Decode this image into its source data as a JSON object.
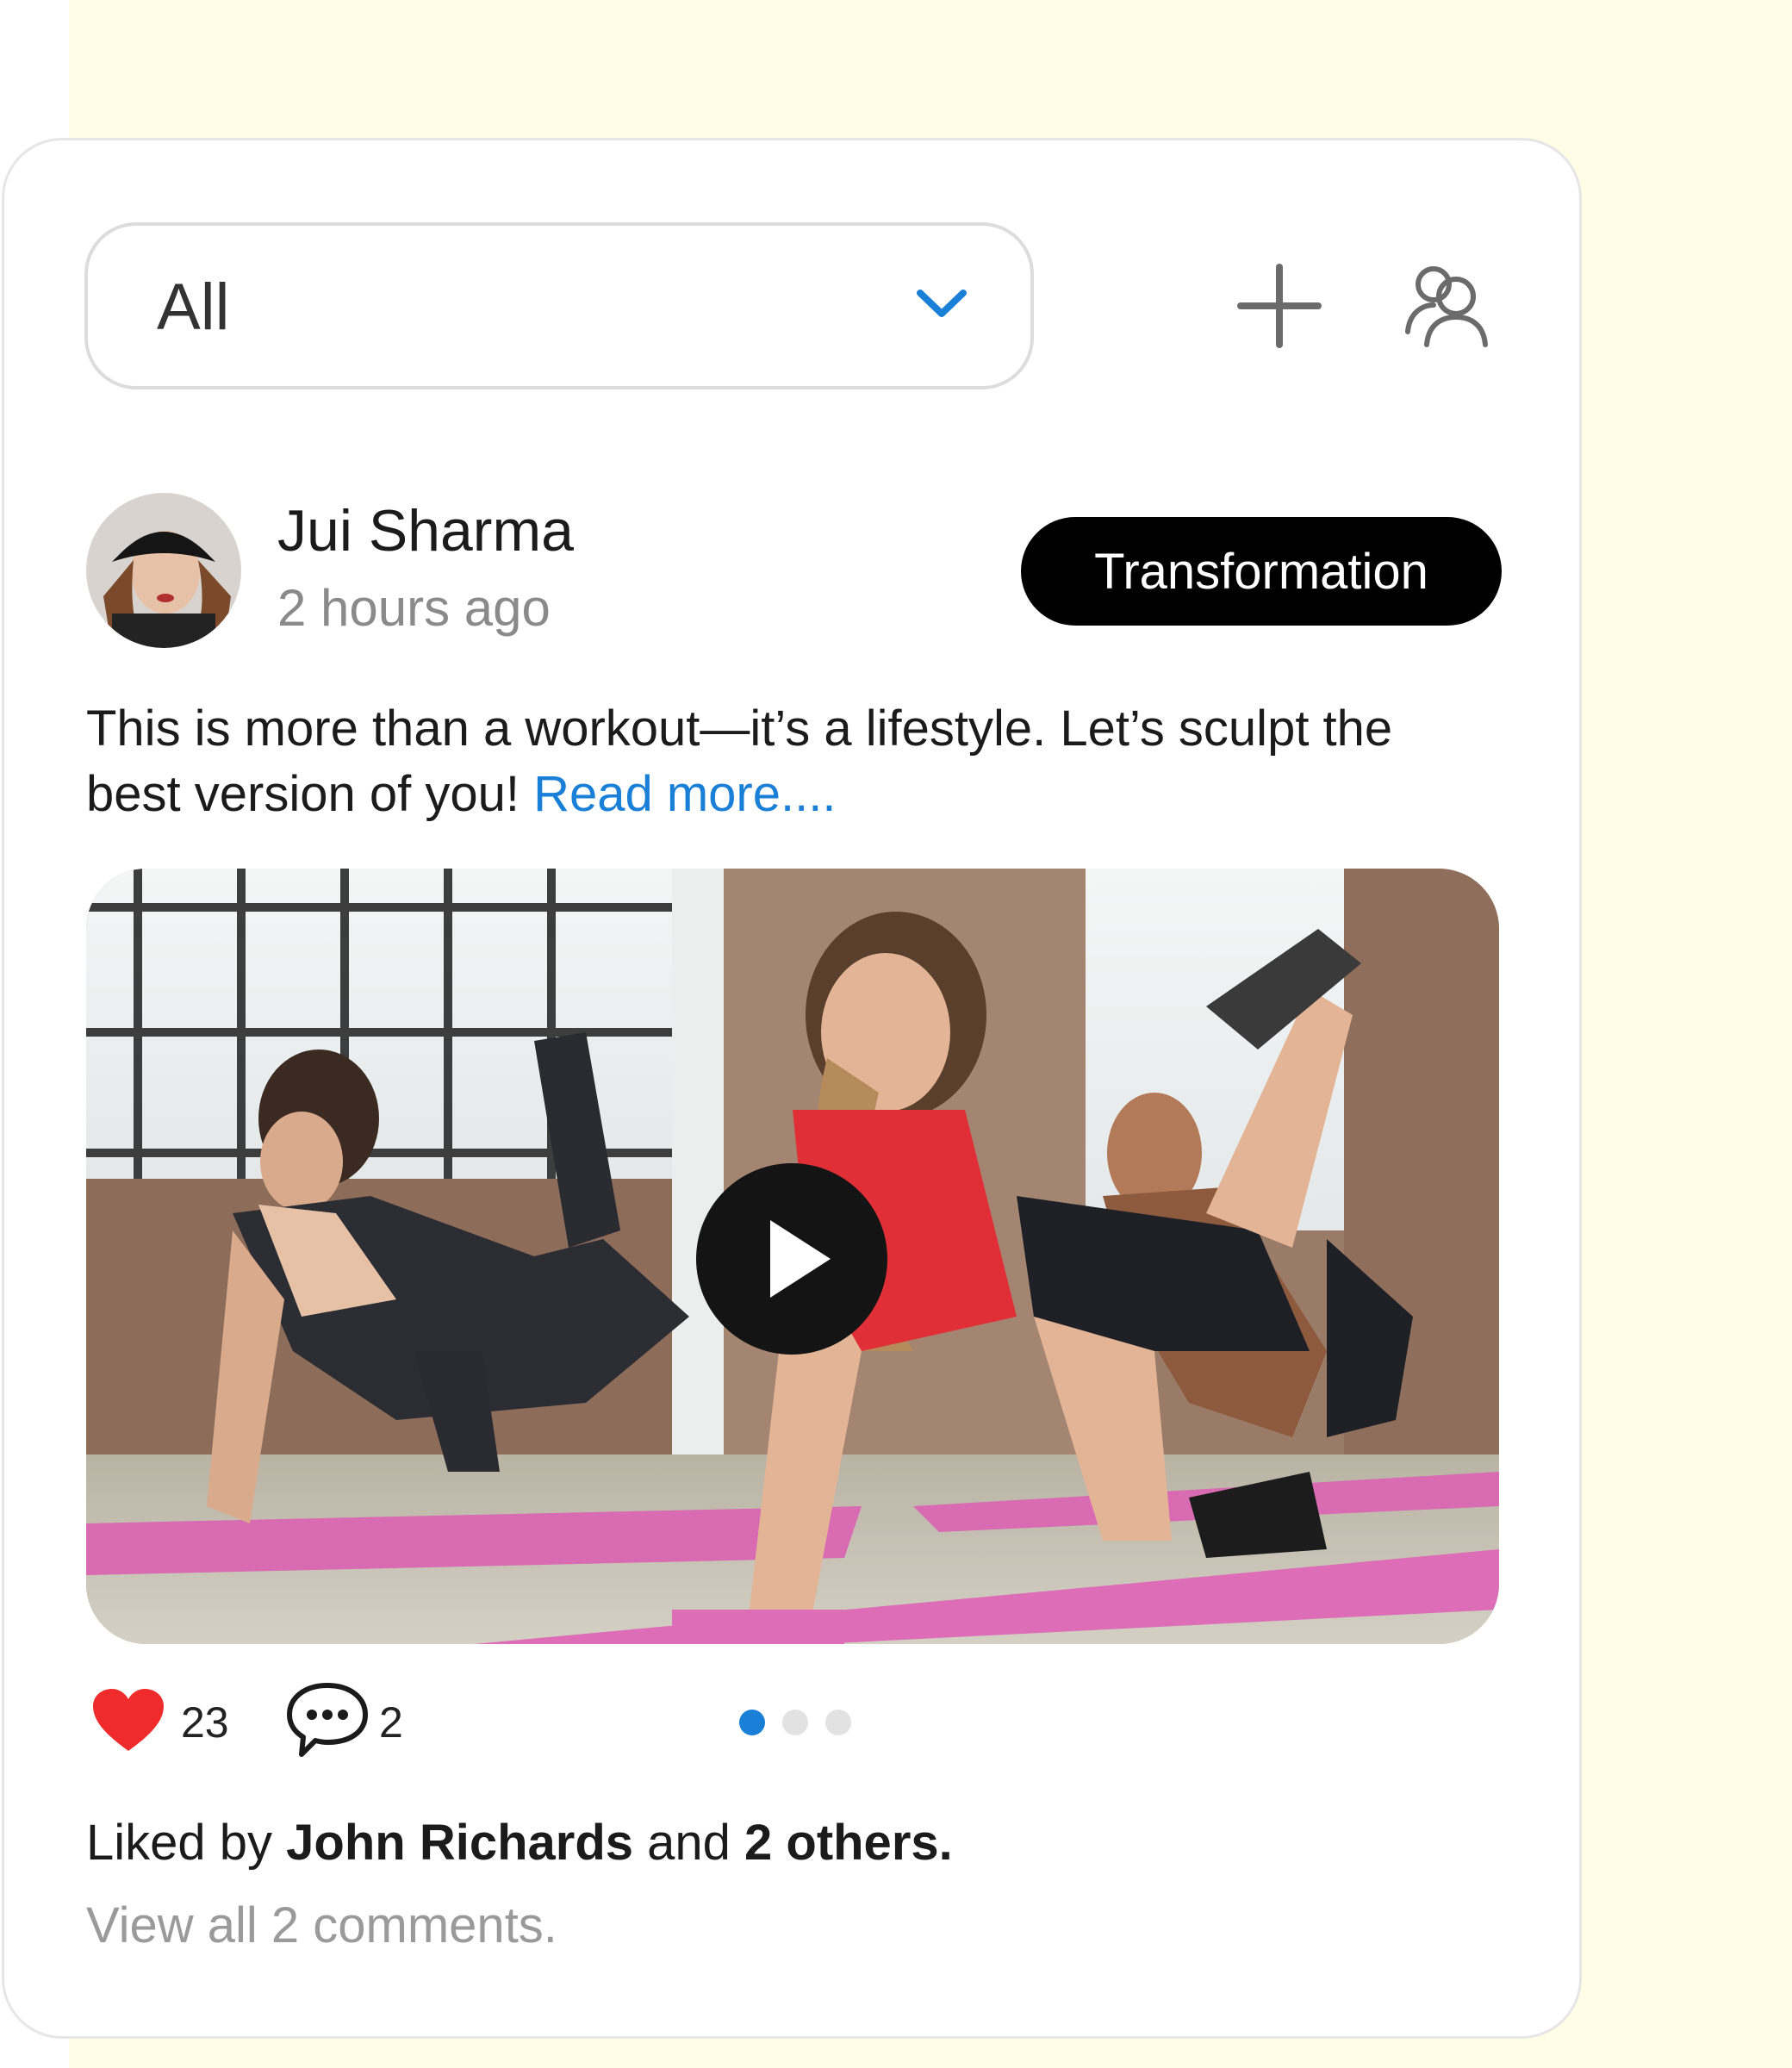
{
  "filter": {
    "value": "All"
  },
  "post": {
    "author": "Jui Sharma",
    "time": "2 hours ago",
    "tag": "Transformation",
    "caption": "This is more than a workout—it’s a lifestyle. Let’s sculpt the best version of you! ",
    "read_more": "Read more....",
    "likes": "23",
    "comments": "2",
    "carousel": {
      "count": 3,
      "active": 0
    },
    "liked_by_prefix": "Liked by ",
    "liked_by_name": "John Richards",
    "liked_by_mid": " and ",
    "liked_by_others": "2 others.",
    "view_comments": "View all 2 comments."
  },
  "colors": {
    "accent": "#1a7fd6",
    "heart": "#ef2b2b",
    "background_panel": "#fffde5",
    "tag_bg": "#000000"
  }
}
